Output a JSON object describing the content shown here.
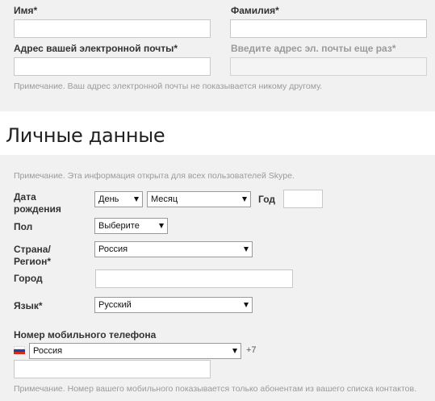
{
  "account": {
    "first_name_label": "Имя*",
    "last_name_label": "Фамилия*",
    "email_label": "Адрес вашей электронной почты*",
    "email_confirm_label": "Введите адрес эл. почты еще раз*",
    "email_note": "Примечание. Ваш адрес электронной почты не показывается никому другому."
  },
  "personal": {
    "title": "Личные данные",
    "note": "Примечание. Эта информация открыта для всех пользователей Skype.",
    "birthdate_label_line1": "Дата",
    "birthdate_label_line2": "рождения",
    "day_value": "День",
    "month_value": "Месяц",
    "year_label": "Год",
    "gender_label": "Пол",
    "gender_value": "Выберите",
    "country_label_line1": "Страна/",
    "country_label_line2": "Регион*",
    "country_value": "Россия",
    "city_label": "Город",
    "language_label": "Язык*",
    "language_value": "Русский",
    "phone_label": "Номер мобильного телефона",
    "phone_country_value": "Россия",
    "phone_code": "+7",
    "phone_note": "Примечание. Номер вашего мобильного показывается только абонентам из вашего списка контактов."
  },
  "colors": {
    "background": "#f1f1f1",
    "band": "#ffffff",
    "flag_white": "#ffffff",
    "flag_blue": "#1c3fa8",
    "flag_red": "#d52b1e"
  }
}
